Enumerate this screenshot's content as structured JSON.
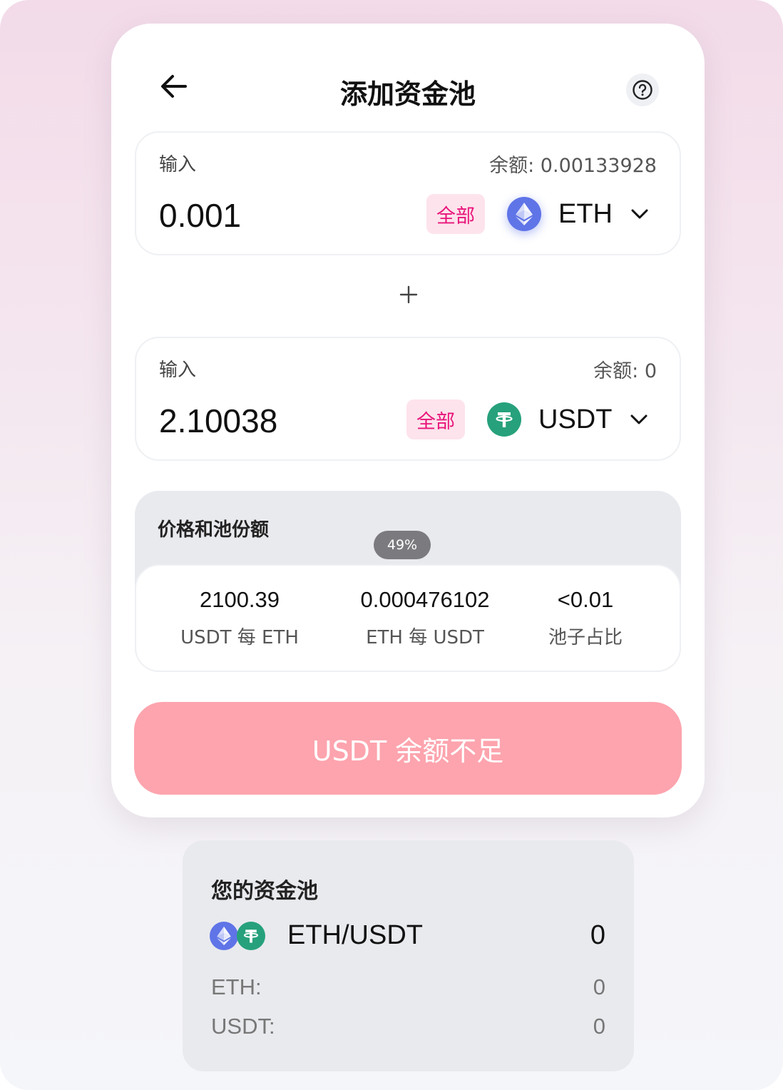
{
  "header": {
    "title": "添加资金池"
  },
  "input_a": {
    "label": "输入",
    "balance": "余额: 0.00133928",
    "amount": "0.001",
    "max_label": "全部",
    "token_symbol": "ETH",
    "token_icon": "ethereum-icon",
    "token_color": "#5f74e7"
  },
  "input_b": {
    "label": "输入",
    "balance": "余额: 0",
    "amount": "2.10038",
    "max_label": "全部",
    "token_symbol": "USDT",
    "token_icon": "tether-icon",
    "token_color": "#26a17b"
  },
  "price": {
    "title": "价格和池份额",
    "badge": "49%",
    "stats": [
      {
        "value": "2100.39",
        "label": "USDT 每 ETH"
      },
      {
        "value": "0.000476102",
        "label": "ETH 每 USDT"
      },
      {
        "value": "<0.01",
        "label": "池子占比"
      }
    ]
  },
  "submit": {
    "label": "USDT 余额不足",
    "color": "#fda4ae"
  },
  "pool": {
    "title": "您的资金池",
    "pair": "ETH/USDT",
    "pair_value": "0",
    "rows": [
      {
        "label": "ETH:",
        "value": "0"
      },
      {
        "label": "USDT:",
        "value": "0"
      }
    ]
  },
  "colors": {
    "accent": "#e8157a",
    "max_bg": "#fde3ec"
  }
}
